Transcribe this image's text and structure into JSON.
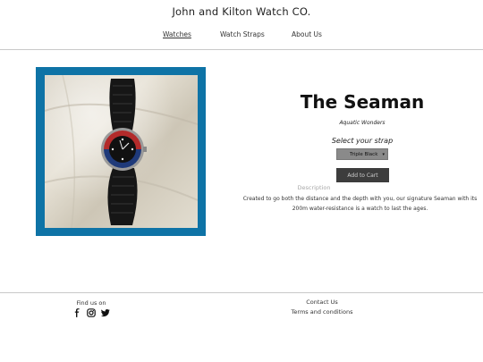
{
  "header": {
    "site_title": "John and Kilton Watch CO.",
    "nav": [
      {
        "label": "Watches",
        "active": true
      },
      {
        "label": "Watch Straps",
        "active": false
      },
      {
        "label": "About Us",
        "active": false
      }
    ]
  },
  "product": {
    "name": "The Seaman",
    "tagline": "Aquatic Wonders",
    "strap_label": "Select your strap",
    "strap_selected": "Triple Black",
    "add_to_cart": "Add to Cart",
    "description_label": "Description",
    "description": "Created to go both the distance and the depth with you, our signature Seaman with its 200m water-resistance is a watch to last the ages.",
    "frame_color": "#0e73a6"
  },
  "footer": {
    "find_us": "Find us on",
    "social_icons": [
      "facebook-icon",
      "instagram-icon",
      "twitter-icon"
    ],
    "contact": "Contact Us",
    "terms": "Terms and conditions"
  }
}
